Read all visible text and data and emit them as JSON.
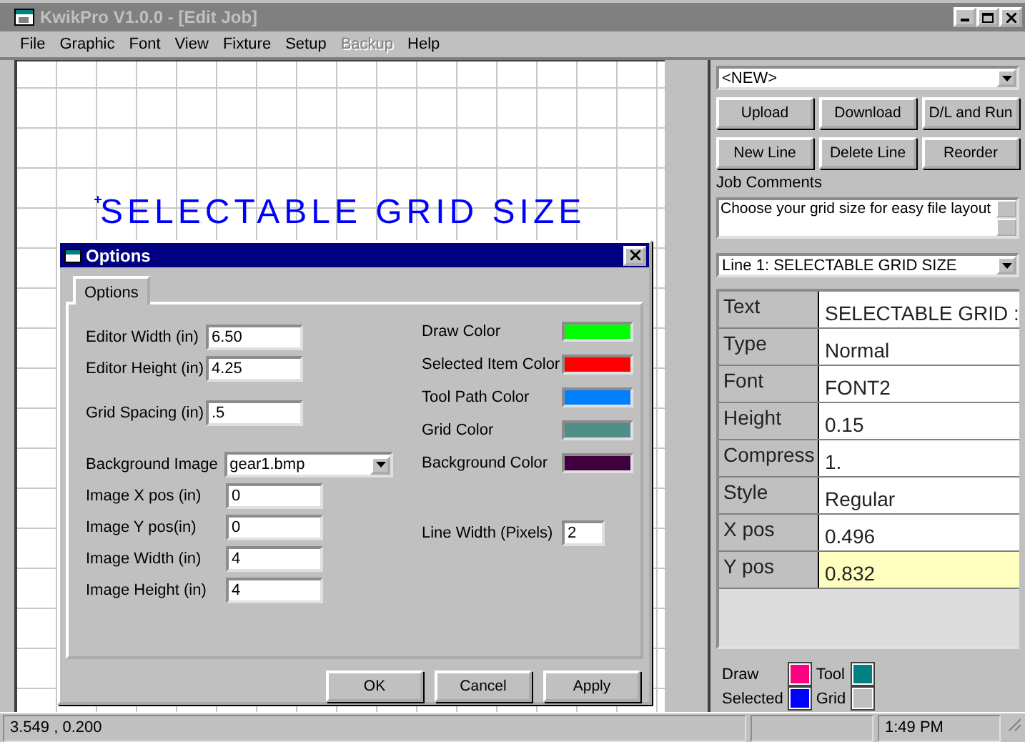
{
  "window": {
    "title": "KwikPro  V1.0.0 - [Edit Job]"
  },
  "menu": [
    {
      "label": "File",
      "disabled": false
    },
    {
      "label": "Graphic",
      "disabled": false
    },
    {
      "label": "Font",
      "disabled": false
    },
    {
      "label": "View",
      "disabled": false
    },
    {
      "label": "Fixture",
      "disabled": false
    },
    {
      "label": "Setup",
      "disabled": false
    },
    {
      "label": "Backup",
      "disabled": true
    },
    {
      "label": "Help",
      "disabled": false
    }
  ],
  "canvas": {
    "text": "SELECTABLE GRID SIZE"
  },
  "side_panel": {
    "job_select": "<NEW>",
    "buttons": [
      "Upload",
      "Download",
      "D/L and Run",
      "New Line",
      "Delete Line",
      "Reorder"
    ],
    "job_comments_label": "Job Comments",
    "job_comments": "Choose your grid size for easy file layout",
    "line_select": "Line 1: SELECTABLE GRID SIZE",
    "properties": [
      {
        "name": "Text",
        "value": "SELECTABLE GRID :",
        "selected": false
      },
      {
        "name": "Type",
        "value": "Normal",
        "selected": false
      },
      {
        "name": "Font",
        "value": "FONT2",
        "selected": false
      },
      {
        "name": "Height",
        "value": "0.15",
        "selected": false
      },
      {
        "name": "Compress",
        "value": "1.",
        "selected": false
      },
      {
        "name": "Style",
        "value": "Regular",
        "selected": false
      },
      {
        "name": "X pos",
        "value": "0.496",
        "selected": false
      },
      {
        "name": "Y pos",
        "value": "0.832",
        "selected": true
      }
    ],
    "legend": [
      {
        "label": "Draw",
        "color": "#ff0080"
      },
      {
        "label": "Tool",
        "color": "#008080"
      },
      {
        "label": "Selected",
        "color": "#0000ff"
      },
      {
        "label": "Grid",
        "color": "#c0c0c0"
      }
    ]
  },
  "dialog": {
    "title": "Options",
    "tabs": [
      {
        "label": "Options",
        "selected": true
      }
    ],
    "editor_fields": [
      {
        "label": "Editor Width (in)",
        "value": "6.50",
        "kind": "text"
      },
      {
        "label": "Editor Height (in)",
        "value": "4.25",
        "kind": "text"
      },
      {
        "label": "Grid Spacing (in)",
        "value": ".5",
        "kind": "text"
      }
    ],
    "image_fields": [
      {
        "label": "Background Image",
        "value": "gear1.bmp",
        "kind": "dropdown"
      },
      {
        "label": "Image X pos (in)",
        "value": "0",
        "kind": "text"
      },
      {
        "label": "Image Y pos(in)",
        "value": "0",
        "kind": "text"
      },
      {
        "label": "Image Width (in)",
        "value": "4",
        "kind": "text"
      },
      {
        "label": "Image Height (in)",
        "value": "4",
        "kind": "text"
      }
    ],
    "colors": [
      {
        "label": "Draw Color",
        "color": "#00ff00"
      },
      {
        "label": "Selected Item Color",
        "color": "#ff0000"
      },
      {
        "label": "Tool Path Color",
        "color": "#0080ff"
      },
      {
        "label": "Grid Color",
        "color": "#4f8f88"
      },
      {
        "label": "Background Color",
        "color": "#400040"
      }
    ],
    "line_width": {
      "label": "Line Width (Pixels)",
      "value": "2"
    },
    "buttons": [
      "OK",
      "Cancel",
      "Apply"
    ]
  },
  "status_bar": {
    "coords": "3.549 , 0.200",
    "time": "1:49 PM"
  }
}
